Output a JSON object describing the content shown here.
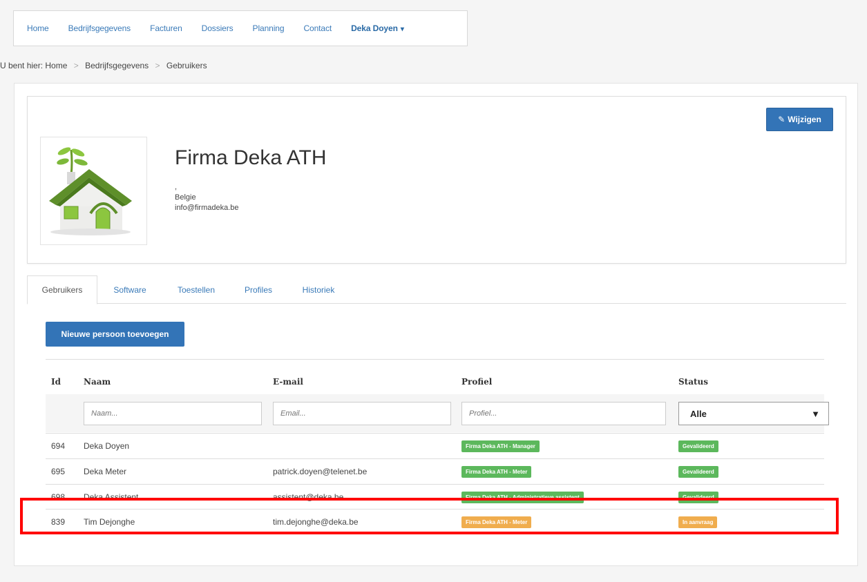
{
  "nav": {
    "items": [
      {
        "label": "Home"
      },
      {
        "label": "Bedrijfsgegevens"
      },
      {
        "label": "Facturen"
      },
      {
        "label": "Dossiers"
      },
      {
        "label": "Planning"
      },
      {
        "label": "Contact"
      },
      {
        "label": "Deka Doyen",
        "caret": "▾"
      }
    ]
  },
  "breadcrumb": {
    "prefix": "U bent hier:",
    "items": [
      "Home",
      "Bedrijfsgegevens",
      "Gebruikers"
    ],
    "separator": ">"
  },
  "company": {
    "edit_icon": "✎",
    "edit_label": "Wijzigen",
    "name": "Firma Deka ATH",
    "line1": ",",
    "country": "Belgie",
    "email": "info@firmadeka.be",
    "logo_icon": "house-logo-icon"
  },
  "tabs": [
    {
      "label": "Gebruikers"
    },
    {
      "label": "Software"
    },
    {
      "label": "Toestellen"
    },
    {
      "label": "Profiles"
    },
    {
      "label": "Historiek"
    }
  ],
  "users": {
    "new_button": "Nieuwe persoon toevoegen",
    "columns": [
      "Id",
      "Naam",
      "E-mail",
      "Profiel",
      "Status"
    ],
    "filters": {
      "name_placeholder": "Naam...",
      "email_placeholder": "Email...",
      "profile_placeholder": "Profiel...",
      "status_value": "Alle",
      "status_arrow": "▼"
    },
    "rows": [
      {
        "id": "694",
        "name": "Deka Doyen",
        "email": "",
        "profile": "Firma Deka ATH - Manager",
        "profile_color": "#5cb85c",
        "status": "Gevalideerd",
        "status_color": "#5cb85c"
      },
      {
        "id": "695",
        "name": "Deka Meter",
        "email": "patrick.doyen@telenet.be",
        "profile": "Firma Deka ATH - Meter",
        "profile_color": "#5cb85c",
        "status": "Gevalideerd",
        "status_color": "#5cb85c"
      },
      {
        "id": "698",
        "name": "Deka Assistent",
        "email": "assistent@deka.be",
        "profile": "Firma Deka ATH - Administratieve assistent",
        "profile_color": "#5cb85c",
        "status": "Gevalideerd",
        "status_color": "#5cb85c"
      },
      {
        "id": "839",
        "name": "Tim Dejonghe",
        "email": "tim.dejonghe@deka.be",
        "profile": "Firma Deka ATH - Meter",
        "profile_color": "#f0ad4e",
        "status": "In aanvraag",
        "status_color": "#f0ad4e"
      }
    ]
  },
  "colors": {
    "primary": "#3374b7",
    "success": "#5cb85c",
    "warning": "#f0ad4e",
    "highlight": "#ff0000"
  }
}
